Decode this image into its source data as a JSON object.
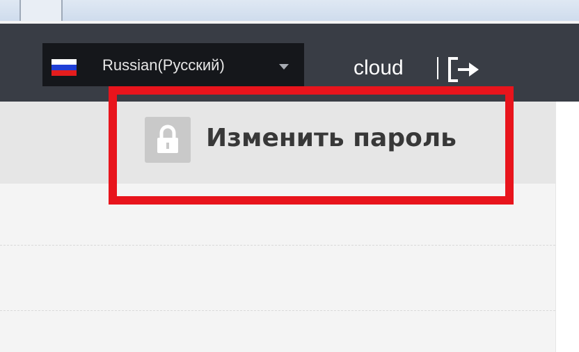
{
  "header": {
    "language": {
      "label": "Russian(Русский)",
      "flag_icon": "russian-flag-icon",
      "dropdown_icon": "chevron-down-icon"
    },
    "username": "cloud",
    "separator": "|",
    "logout_icon": "logout-icon"
  },
  "menu": {
    "change_password": {
      "label": "Изменить пароль",
      "icon": "lock-icon"
    }
  },
  "colors": {
    "header_bg": "#393d45",
    "select_bg": "#15171b",
    "highlight": "#e8141c",
    "menu_bg": "#e6e6e6"
  }
}
